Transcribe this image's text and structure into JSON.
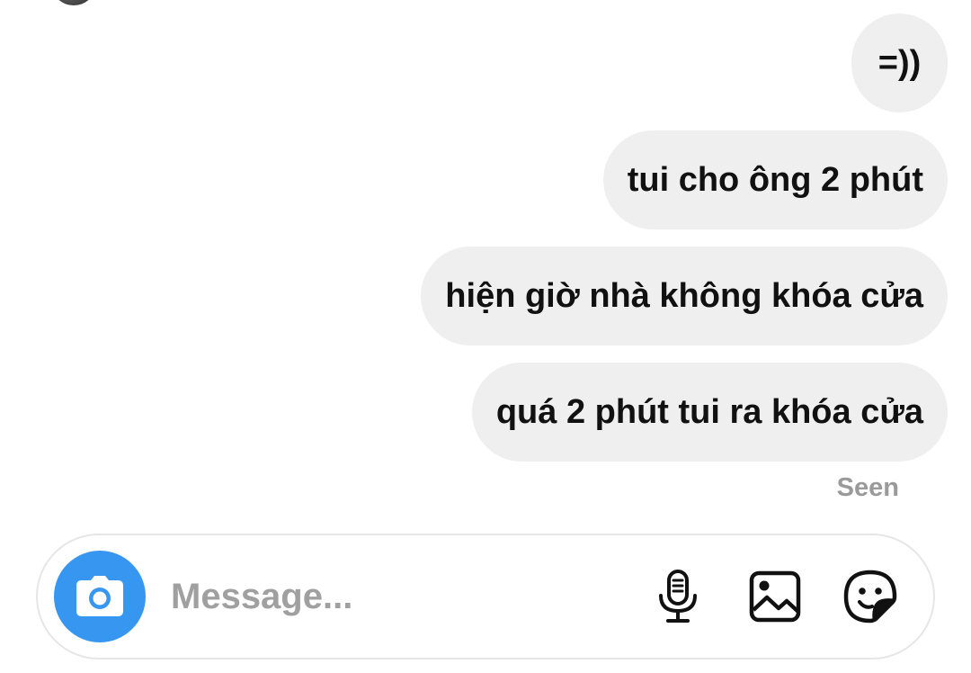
{
  "conversation": {
    "messages": [
      {
        "text": "=))"
      },
      {
        "text": "tui cho ông 2 phút"
      },
      {
        "text": "hiện giờ nhà không khóa cửa"
      },
      {
        "text": "quá 2 phút tui ra khóa cửa"
      }
    ],
    "status": "Seen"
  },
  "composer": {
    "placeholder": "Message...",
    "icons": {
      "camera": "camera-icon",
      "mic": "microphone-icon",
      "gallery": "image-icon",
      "sticker": "sticker-icon"
    },
    "accent_color": "#3797f0"
  },
  "colors": {
    "bubble_bg": "#efefef",
    "text": "#111111",
    "muted": "#9a9a9a"
  }
}
